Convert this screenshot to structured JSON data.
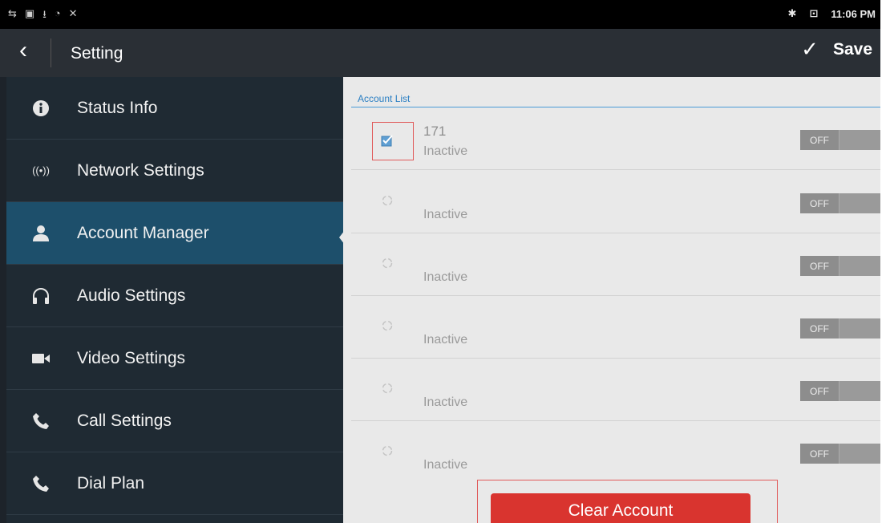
{
  "status_bar": {
    "left_icons": [
      "usb-icon",
      "screenshot-icon",
      "upload-icon",
      "wifi-icon",
      "bug-icon"
    ],
    "time": "11:06 PM"
  },
  "header": {
    "title": "Setting",
    "save_label": "Save"
  },
  "sidebar": {
    "items": [
      {
        "label": "Status Info",
        "icon": "info-icon",
        "active": false
      },
      {
        "label": "Network Settings",
        "icon": "network-icon",
        "active": false
      },
      {
        "label": "Account Manager",
        "icon": "person-icon",
        "active": true
      },
      {
        "label": "Audio Settings",
        "icon": "headset-icon",
        "active": false
      },
      {
        "label": "Video Settings",
        "icon": "camera-icon",
        "active": false
      },
      {
        "label": "Call Settings",
        "icon": "phone-icon",
        "active": false
      },
      {
        "label": "Dial Plan",
        "icon": "phone-icon",
        "active": false
      }
    ]
  },
  "main": {
    "list_header": "Account List",
    "accounts": [
      {
        "name": "171",
        "status": "Inactive",
        "checked": true,
        "toggle": "OFF"
      },
      {
        "name": "",
        "status": "Inactive",
        "checked": false,
        "toggle": "OFF"
      },
      {
        "name": "",
        "status": "Inactive",
        "checked": false,
        "toggle": "OFF"
      },
      {
        "name": "",
        "status": "Inactive",
        "checked": false,
        "toggle": "OFF"
      },
      {
        "name": "",
        "status": "Inactive",
        "checked": false,
        "toggle": "OFF"
      },
      {
        "name": "",
        "status": "Inactive",
        "checked": false,
        "toggle": "OFF"
      }
    ],
    "clear_button": "Clear Account"
  },
  "colors": {
    "accent": "#2b7fc3",
    "active_nav": "#1d4f6b",
    "danger": "#d9342f"
  }
}
